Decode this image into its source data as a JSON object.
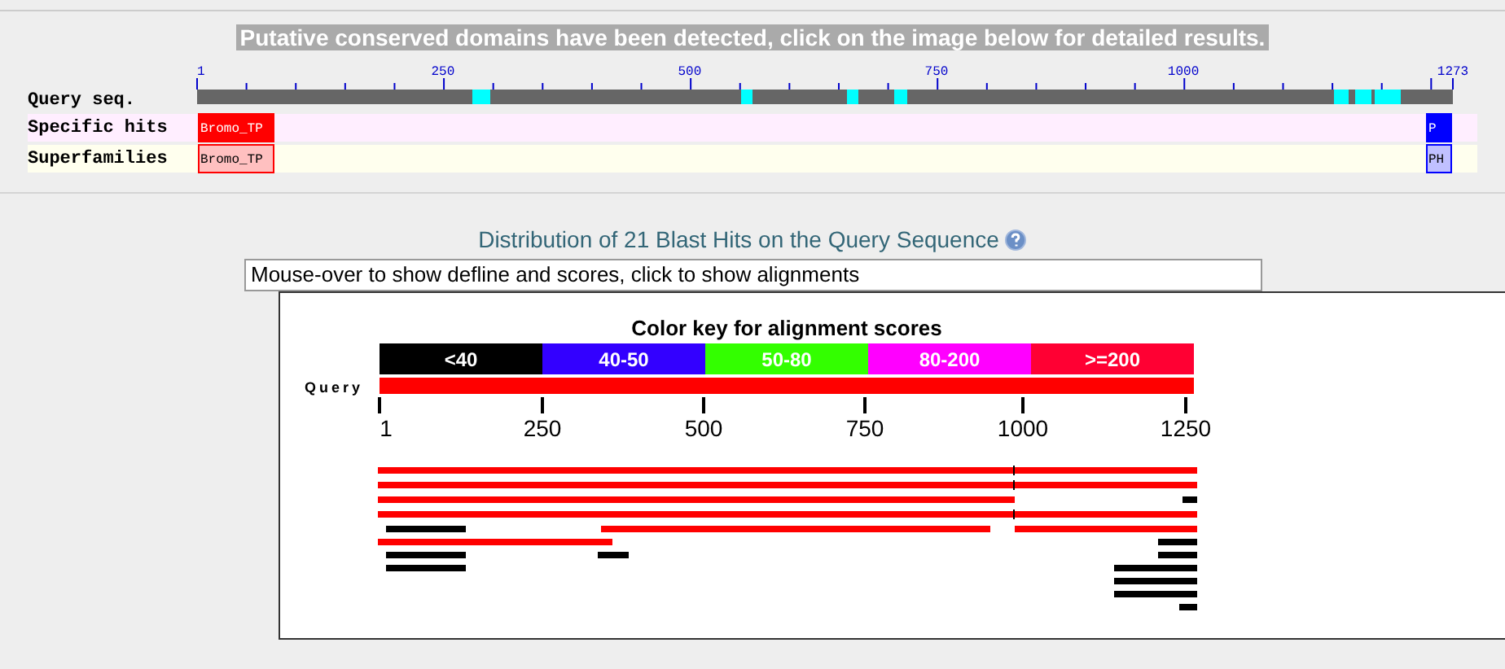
{
  "banner": "Putative conserved domains have been detected, click on the image below for detailed results.",
  "domains": {
    "scale_labels": [
      "1",
      "250",
      "500",
      "750",
      "1000",
      "1273"
    ],
    "rows": [
      {
        "label": "Query seq.",
        "kind": "query"
      },
      {
        "label": "Specific hits",
        "kind": "specific",
        "hits": [
          {
            "label": "Bromo_TP",
            "kind": "specific"
          },
          {
            "label": "P",
            "kind": "specific-small"
          }
        ]
      },
      {
        "label": "Superfamilies",
        "kind": "superfamily",
        "hits": [
          {
            "label": "Bromo_TP",
            "kind": "superfamily"
          },
          {
            "label": "PH",
            "kind": "superfamily-small"
          }
        ]
      }
    ]
  },
  "distribution": {
    "title": "Distribution of 21 Blast Hits on the Query Sequence",
    "info": "Mouse-over to show defline and scores, click to show alignments",
    "key_title": "Color key for alignment scores",
    "key": [
      {
        "label": "<40",
        "color": "#000000"
      },
      {
        "label": "40-50",
        "color": "#3300ff"
      },
      {
        "label": "50-80",
        "color": "#33ff00"
      },
      {
        "label": "80-200",
        "color": "#ff00ff"
      },
      {
        "label": ">=200",
        "color": "#ff0033"
      }
    ],
    "query_label": "Query",
    "axis_labels": [
      "1",
      "250",
      "500",
      "750",
      "1000",
      "1250"
    ]
  }
}
